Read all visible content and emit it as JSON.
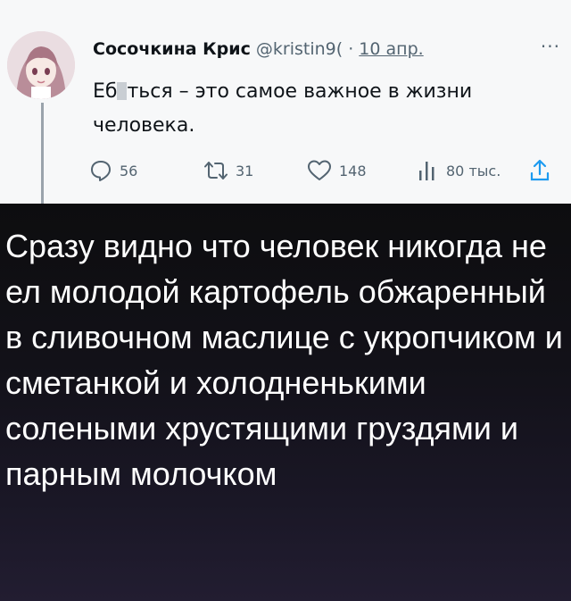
{
  "tweet": {
    "author_name": "Сосочкина Крис",
    "handle": "@kristin9(",
    "separator": "·",
    "date": "10 апр.",
    "more_menu": "···",
    "text_prefix": "Еб",
    "text_suffix": "ться – это самое важное в жизни человека.",
    "actions": {
      "replies": "56",
      "retweets": "31",
      "likes": "148",
      "views": "80 тыс."
    },
    "icons": [
      "avatar-image",
      "reply-icon",
      "retweet-icon",
      "like-icon",
      "views-icon",
      "share-icon"
    ]
  },
  "caption": {
    "text": "Сразу видно что человек никогда не ел молодой картофель обжаренный в сливочном маслице с укропчиком и сметанкой и холодненькими солеными хрустящими груздями и парным молочком"
  },
  "colors": {
    "tweet_bg": "#f7f8f9",
    "muted": "#536471",
    "caption_bg": "#121118",
    "caption_text": "#ffffff"
  }
}
